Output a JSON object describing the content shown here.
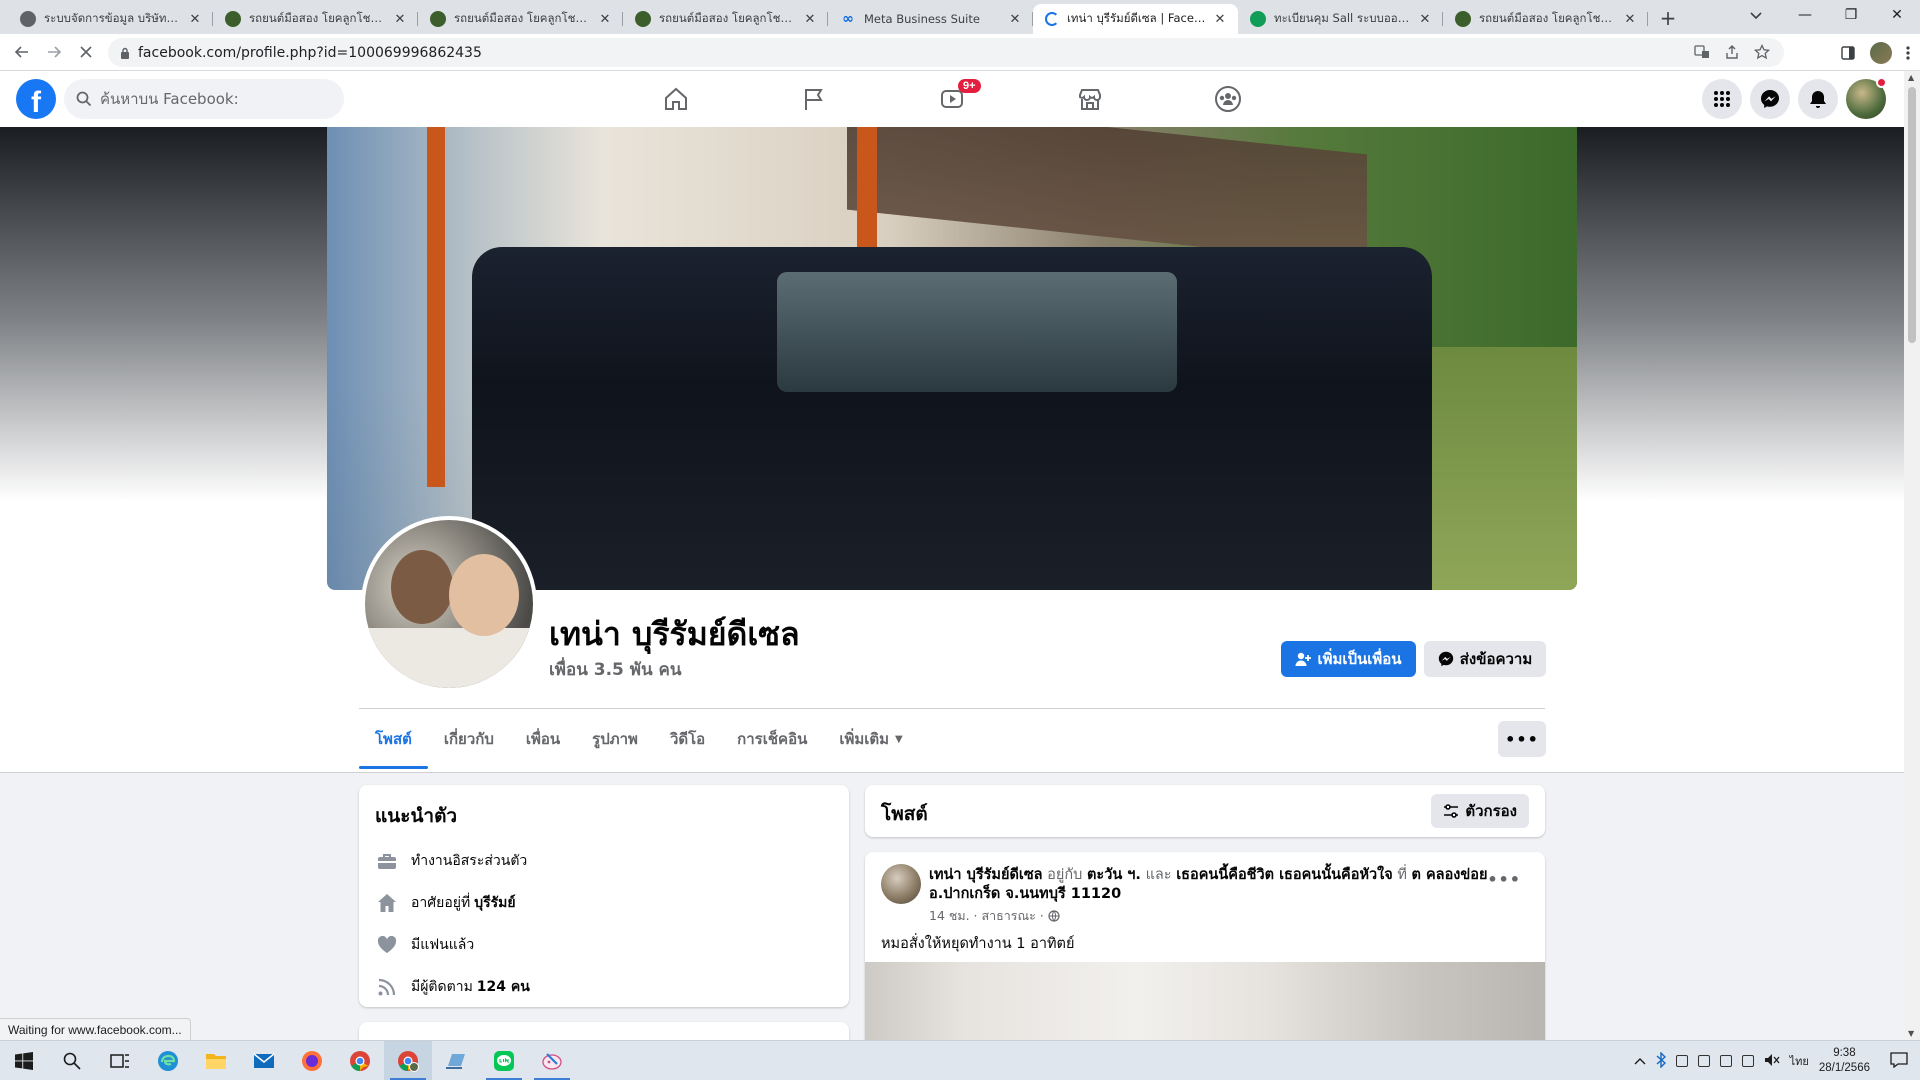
{
  "browser": {
    "tabs": [
      {
        "label": "ระบบจัดการข้อมูล บริษัท โยคลูกโชค อุดร",
        "favicon": "globe",
        "active": false
      },
      {
        "label": "รถยนต์มือสอง โยคลูกโชค อุดรธานี",
        "favicon": "site",
        "active": false
      },
      {
        "label": "รถยนต์มือสอง โยคลูกโชค อุดรธานี",
        "favicon": "site",
        "active": false
      },
      {
        "label": "รถยนต์มือสอง โยคลูกโชค อุดรธานี",
        "favicon": "site",
        "active": false
      },
      {
        "label": "Meta Business Suite",
        "favicon": "meta",
        "active": false
      },
      {
        "label": "เทน่า บุรีรัมย์ดีเซล | Facebook",
        "favicon": "loading",
        "active": true
      },
      {
        "label": "ทะเบียนคุม Sall ระบบออนไลน์",
        "favicon": "sheets",
        "active": false
      },
      {
        "label": "รถยนต์มือสอง โยคลูกโชค อุดรธานี",
        "favicon": "site",
        "active": false
      }
    ],
    "url": "facebook.com/profile.php?id=100069996862435",
    "status_text": "Waiting for www.facebook.com..."
  },
  "facebook": {
    "logo_letter": "f",
    "search_placeholder": "ค้นหาบน Facebook:",
    "video_badge": "9+",
    "brand_color": "#1877f2"
  },
  "profile": {
    "name": "เทน่า บุรีรัมย์ดีเซล",
    "friends": "เพื่อน 3.5 พัน คน",
    "add_friend_label": "เพิ่มเป็นเพื่อน",
    "message_label": "ส่งข้อความ",
    "tabs": [
      {
        "label": "โพสต์",
        "active": true
      },
      {
        "label": "เกี่ยวกับ",
        "active": false
      },
      {
        "label": "เพื่อน",
        "active": false
      },
      {
        "label": "รูปภาพ",
        "active": false
      },
      {
        "label": "วิดีโอ",
        "active": false
      },
      {
        "label": "การเช็คอิน",
        "active": false
      },
      {
        "label": "เพิ่มเติม",
        "active": false
      }
    ]
  },
  "intro": {
    "title": "แนะนำตัว",
    "work": "ทำงานอิสระส่วนตัว",
    "lives_prefix": "อาศัยอยู่ที่",
    "lives_place": "บุรีรัมย์",
    "relationship": "มีแฟนแล้ว",
    "followers_prefix": "มีผู้ติดตาม",
    "followers_count": "124 คน"
  },
  "posts": {
    "title": "โพสต์",
    "filter_label": "ตัวกรอง",
    "items": [
      {
        "author": "เทน่า บุรีรัมย์ดีเซล",
        "with_word": "อยู่กับ",
        "with_name": "ตะวัน ฯ.",
        "and_word": "และ",
        "with_name2": "เธอคนนี้คือชีวิต เธอคนนั้นคือหัวใจ",
        "at_word": "ที่",
        "place": "ต คลองข่อย อ.ปากเกร็ด จ.นนทบุรี 11120",
        "meta": "14 ชม. · สาธารณะ ·",
        "text": "หมอสั่งให้หยุดทำงาน 1 อาทิตย์"
      }
    ]
  },
  "taskbar": {
    "time": "9:38",
    "date": "28/1/2566",
    "lang": "ไทย"
  }
}
